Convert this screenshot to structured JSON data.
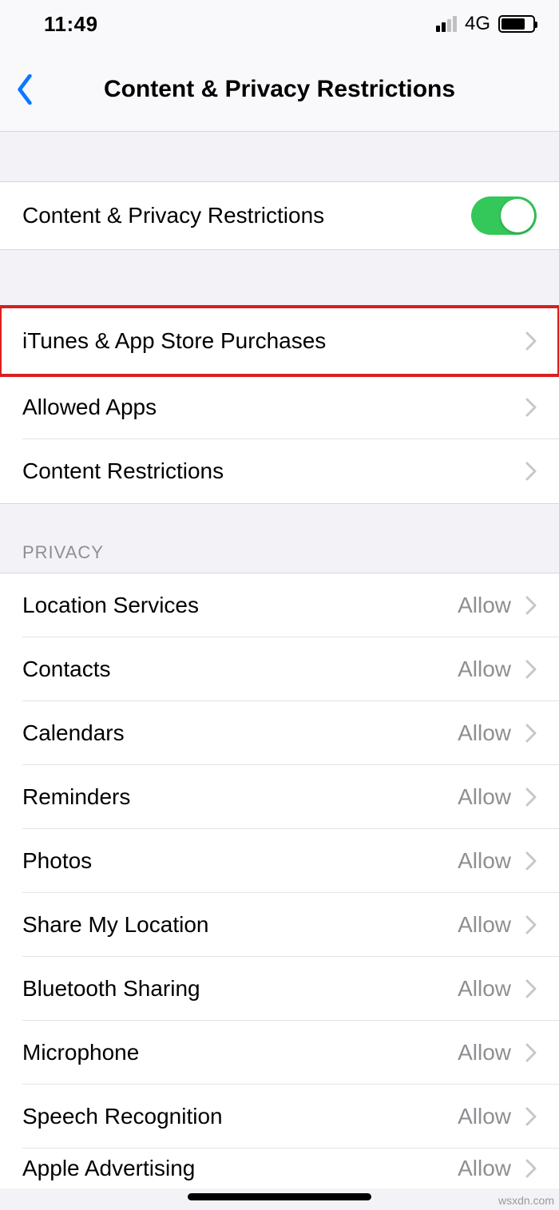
{
  "status": {
    "time": "11:49",
    "network": "4G"
  },
  "header": {
    "title": "Content & Privacy Restrictions"
  },
  "toggle": {
    "label": "Content & Privacy Restrictions"
  },
  "section1": {
    "items": [
      {
        "label": "iTunes & App Store Purchases"
      },
      {
        "label": "Allowed Apps"
      },
      {
        "label": "Content Restrictions"
      }
    ]
  },
  "privacy": {
    "header": "PRIVACY",
    "items": [
      {
        "label": "Location Services",
        "value": "Allow"
      },
      {
        "label": "Contacts",
        "value": "Allow"
      },
      {
        "label": "Calendars",
        "value": "Allow"
      },
      {
        "label": "Reminders",
        "value": "Allow"
      },
      {
        "label": "Photos",
        "value": "Allow"
      },
      {
        "label": "Share My Location",
        "value": "Allow"
      },
      {
        "label": "Bluetooth Sharing",
        "value": "Allow"
      },
      {
        "label": "Microphone",
        "value": "Allow"
      },
      {
        "label": "Speech Recognition",
        "value": "Allow"
      },
      {
        "label": "Apple Advertising",
        "value": "Allow"
      }
    ]
  },
  "watermark": "wsxdn.com"
}
